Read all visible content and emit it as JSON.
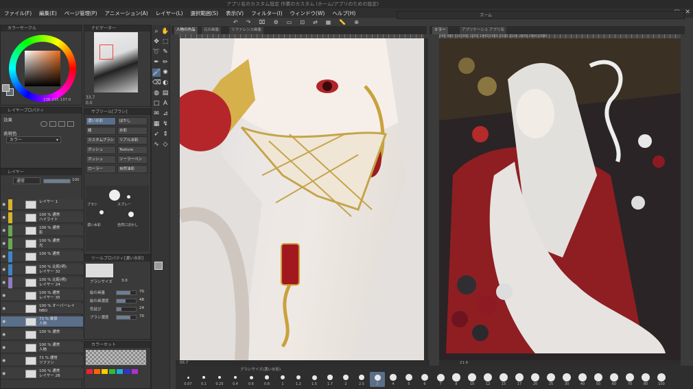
{
  "window": {
    "title": "アプリ名のカスタム設定  作業のカスタム  (ホーム/アプリのための設定)"
  },
  "menu": [
    "ファイル(F)",
    "編集(E)",
    "ページ管理(P)",
    "アニメーション(A)",
    "レイヤー(L)",
    "選択範囲(S)",
    "表示(V)",
    "フィルター(I)",
    "ウィンドウ(W)",
    "ヘルプ(H)"
  ],
  "panels": {
    "color": {
      "title": "カラーサークル",
      "readout": "236  235  137.0"
    },
    "navigator": {
      "title": "ナビゲーター",
      "zoom": "33.7",
      "angle": "0.0"
    },
    "layer_property": {
      "title": "レイヤープロパティ",
      "effect_label": "効果",
      "expression_label": "表現色",
      "expression_value": "カラー"
    },
    "subtool": {
      "title": "サブツール[ブラシ]",
      "brushes": [
        "濃い水彩",
        "ぼかし",
        "線",
        "水彩",
        "カスタムブラシ",
        "リアル水彩",
        "ガッシュ",
        "Texture",
        "ガッシュ",
        "ソーラーペン",
        "ローラー",
        "自然油彩"
      ],
      "tips": [
        "ブラシ",
        "スプレー",
        "濃い水彩",
        "自然にぼかし"
      ]
    },
    "tool_property": {
      "title": "ツールプロパティ[濃い水彩]",
      "brush_size_label": "ブラシサイズ",
      "brush_size": "3.0",
      "rows": [
        "絵の具量",
        "絵の具濃度",
        "色延び",
        "ブラシ濃度"
      ],
      "values": [
        "70",
        "48",
        "24",
        "70"
      ]
    },
    "color_set": {
      "title": "カラーセット"
    },
    "layer": {
      "title": "レイヤー",
      "blend_mode": "通常",
      "opacity": "100",
      "rows": [
        {
          "name": "レイヤー 1",
          "sub": "",
          "sel": false
        },
        {
          "name": "100 % 通常",
          "sub": "ハイライト",
          "sel": false
        },
        {
          "name": "100 % 通常",
          "sub": "影",
          "sel": false
        },
        {
          "name": "100 % 通常",
          "sub": "光",
          "sel": false
        },
        {
          "name": "100 % 通常",
          "sub": "",
          "sel": false
        },
        {
          "name": "100 % 比較(明)",
          "sub": "レイヤー 32",
          "sel": false
        },
        {
          "name": "100 % 比較(明)",
          "sub": "レイヤー 24",
          "sel": false
        },
        {
          "name": "100 % 通常",
          "sub": "レイヤー 35",
          "sel": false
        },
        {
          "name": "100 % オーバーレイ",
          "sub": "NBO",
          "sel": false
        },
        {
          "name": "73 % 乗算",
          "sub": "人物",
          "sel": true
        },
        {
          "name": "100 % 通常",
          "sub": "",
          "sel": false
        },
        {
          "name": "100 % 通常",
          "sub": "人物",
          "sel": false
        },
        {
          "name": "71 % 通常",
          "sub": "ツファン",
          "sel": false
        },
        {
          "name": "100 % 通常",
          "sub": "レイヤー 28",
          "sel": false
        }
      ]
    }
  },
  "canvas": {
    "tabs_left": [
      "人物の作品",
      "元の画像",
      "リファレンス画像"
    ],
    "tabs_right": [
      "ミラー",
      "アプリケーション",
      "アプリ名"
    ],
    "zoom_title": "ズーム",
    "ruler_right": "240  480  720  960  1200  1440  1680  1920  2160  2400  2640  2880",
    "status_left": "66.7",
    "status_right": "21.6",
    "angle": "0.0"
  },
  "brush_size_bar": {
    "title": "ブラシサイズ(濃い水彩)",
    "sizes": [
      "0.07",
      "0.1",
      "0.25",
      "0.4",
      "0.6",
      "0.8",
      "1",
      "1.2",
      "1.5",
      "1.7",
      "2",
      "2.5",
      "3",
      "4",
      "5",
      "6",
      "7",
      "8",
      "10",
      "12",
      "15",
      "17",
      "20",
      "25",
      "30",
      "40",
      "50",
      "60",
      "70",
      "80",
      "100"
    ],
    "selected": "3"
  }
}
